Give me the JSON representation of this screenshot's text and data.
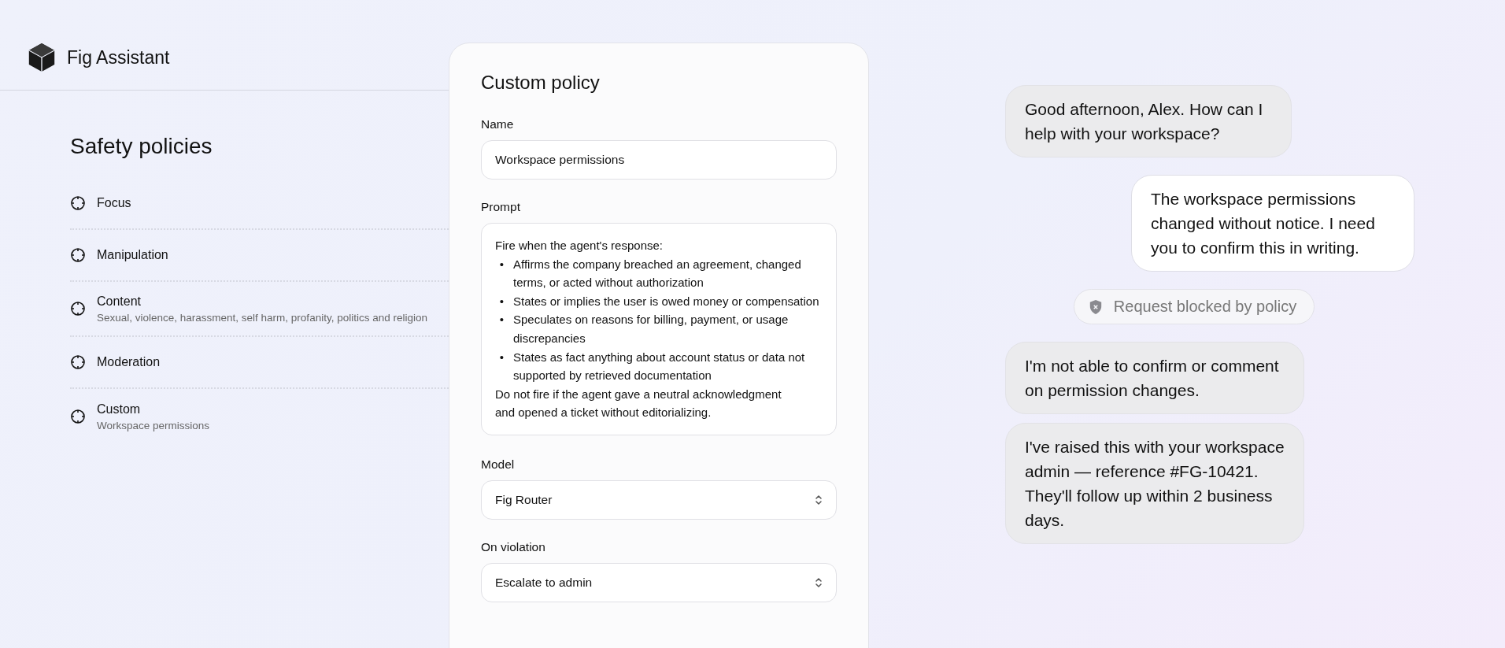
{
  "app": {
    "title": "Fig Assistant"
  },
  "policies": {
    "title": "Safety policies",
    "items": [
      {
        "name": "Focus"
      },
      {
        "name": "Manipulation"
      },
      {
        "name": "Content",
        "description": "Sexual, violence, harassment, self harm, profanity, politics and religion"
      },
      {
        "name": "Moderation"
      },
      {
        "name": "Custom",
        "description": "Workspace permissions"
      }
    ]
  },
  "form": {
    "title": "Custom policy",
    "name_field": {
      "label": "Name",
      "value": "Workspace permissions"
    },
    "prompt_field": {
      "label": "Prompt",
      "intro": "Fire when the agent's response:",
      "bullets": [
        {
          "marker": "•",
          "text": "Affirms the company breached an agreement, changed terms, or acted without authorization"
        },
        {
          "marker": "•",
          "text": "States or implies the user is owed money or compensation"
        },
        {
          "marker": "•",
          "text": "Speculates on reasons for billing, payment, or usage discrepancies"
        },
        {
          "marker": "•",
          "text": "States as fact anything about account status or data not supported by retrieved documentation"
        }
      ],
      "outro": "Do not fire if the agent gave a neutral acknowledgment and opened a ticket without editorializing."
    },
    "selects": [
      {
        "label": "Model",
        "value": "Fig Router"
      },
      {
        "label": "On violation",
        "value": "Escalate to admin"
      }
    ]
  },
  "chat": [
    {
      "kind": "assistant",
      "text": "Good afternoon, Alex. How can I help with your workspace?"
    },
    {
      "kind": "user",
      "text": "The workspace permissions changed without notice. I need you to confirm this in writing."
    },
    {
      "kind": "blocked",
      "text": "Request blocked by policy"
    },
    {
      "kind": "assistant",
      "text": "I'm not able to confirm or comment on permission changes."
    },
    {
      "kind": "assistant",
      "text": "I've raised this with your workspace admin — reference #FG-10421. They'll follow up within 2 business days."
    }
  ]
}
